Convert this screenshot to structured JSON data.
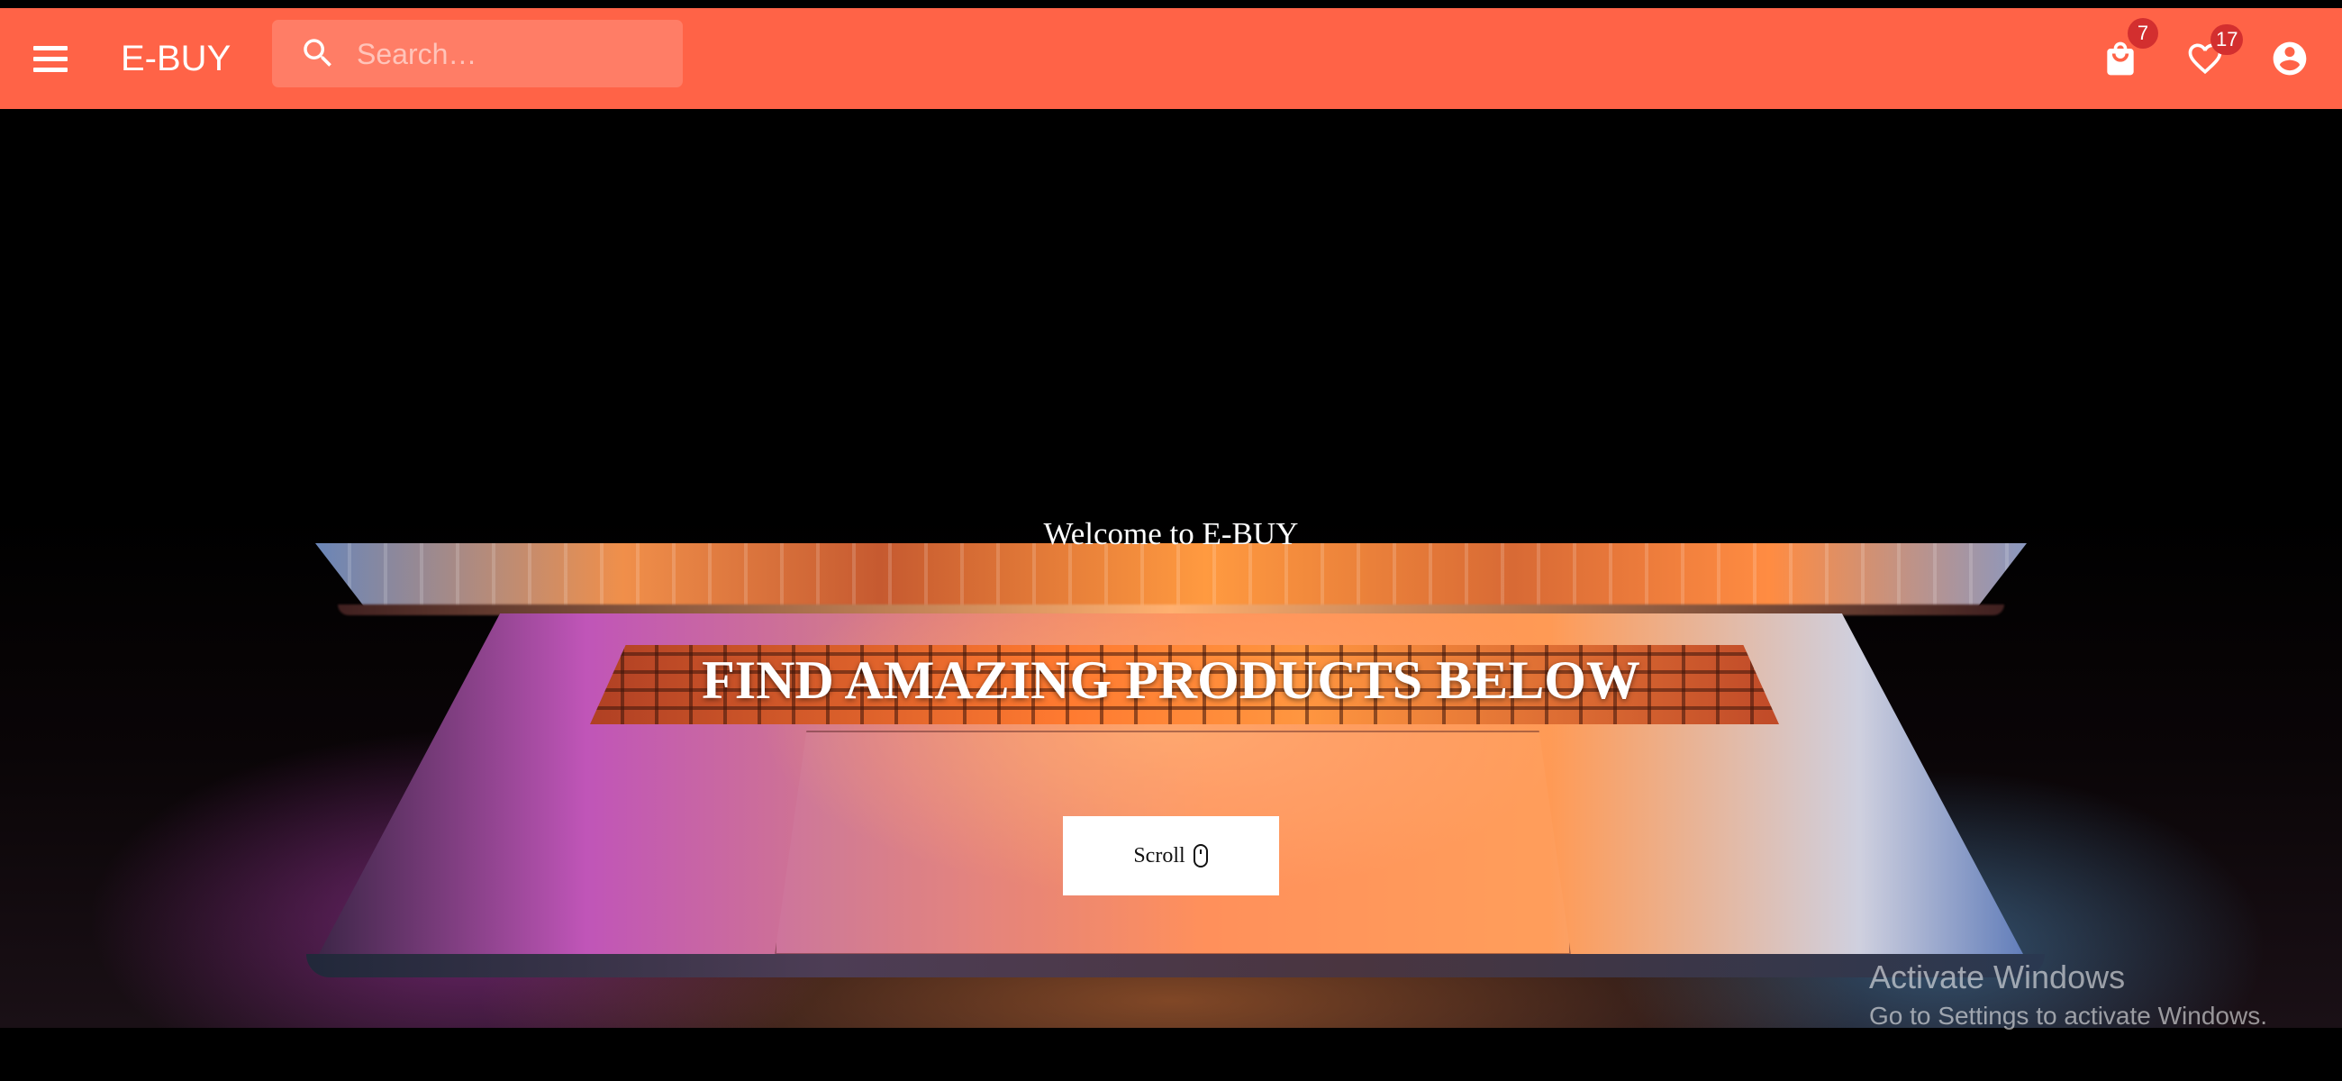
{
  "app": {
    "brand": "E-BUY",
    "accent_color": "#ff6347"
  },
  "search": {
    "placeholder": "Search…"
  },
  "header_icons": {
    "menu": "menu-icon",
    "cart": {
      "icon": "shopping-bag-icon",
      "badge": "7",
      "badge_color": "#d32f2f"
    },
    "wishlist": {
      "icon": "heart-outline-icon",
      "badge": "17",
      "badge_color": "#d32f2f"
    },
    "account": {
      "icon": "account-circle-icon"
    }
  },
  "hero": {
    "welcome": "Welcome to E-BUY",
    "headline": "FIND AMAZING PRODUCTS BELOW",
    "scroll_label": "Scroll",
    "scroll_icon": "mouse-icon",
    "background": "laptop-photo"
  },
  "watermark": {
    "line1": "Activate Windows",
    "line2": "Go to Settings to activate Windows."
  }
}
